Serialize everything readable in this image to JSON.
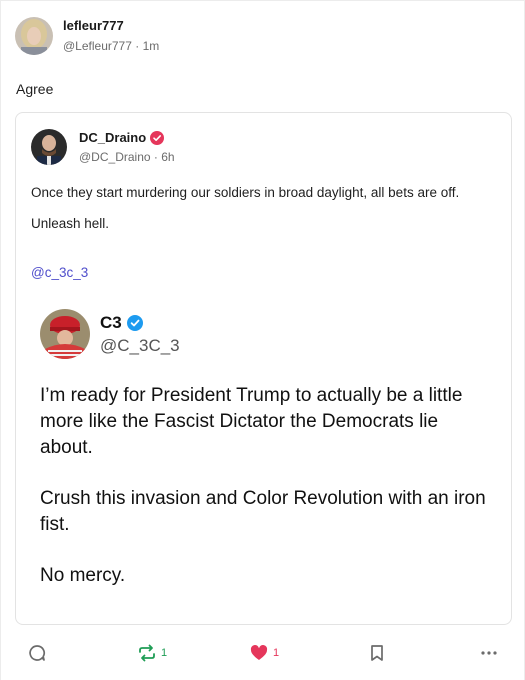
{
  "post": {
    "username": "lefleur777",
    "handle": "@Lefleur777",
    "separator": "·",
    "time": "1m",
    "text": "Agree"
  },
  "quoted": {
    "username": "DC_Draino",
    "handle": "@DC_Draino",
    "separator": "·",
    "time": "6h",
    "paragraphs": [
      "Once they start murdering our soldiers in broad daylight, all bets are off.",
      "Unleash hell."
    ],
    "mention": "@c_3c_3",
    "badge_color": "#e5365b"
  },
  "embedded": {
    "username": "C3",
    "handle": "@C_3C_3",
    "badge_color": "#1d9bf0",
    "paragraphs": [
      "I’m ready for President Trump to actually be a little more like the Fascist Dictator the Democrats lie about.",
      "Crush this invasion and Color Revolution with an iron fist.",
      "No mercy."
    ]
  },
  "actions": {
    "reply_icon": "reply-icon",
    "repost_icon": "repost-icon",
    "repost_count": "1",
    "like_icon": "heart-icon",
    "like_count": "1",
    "bookmark_icon": "bookmark-icon",
    "more_icon": "more-icon"
  }
}
